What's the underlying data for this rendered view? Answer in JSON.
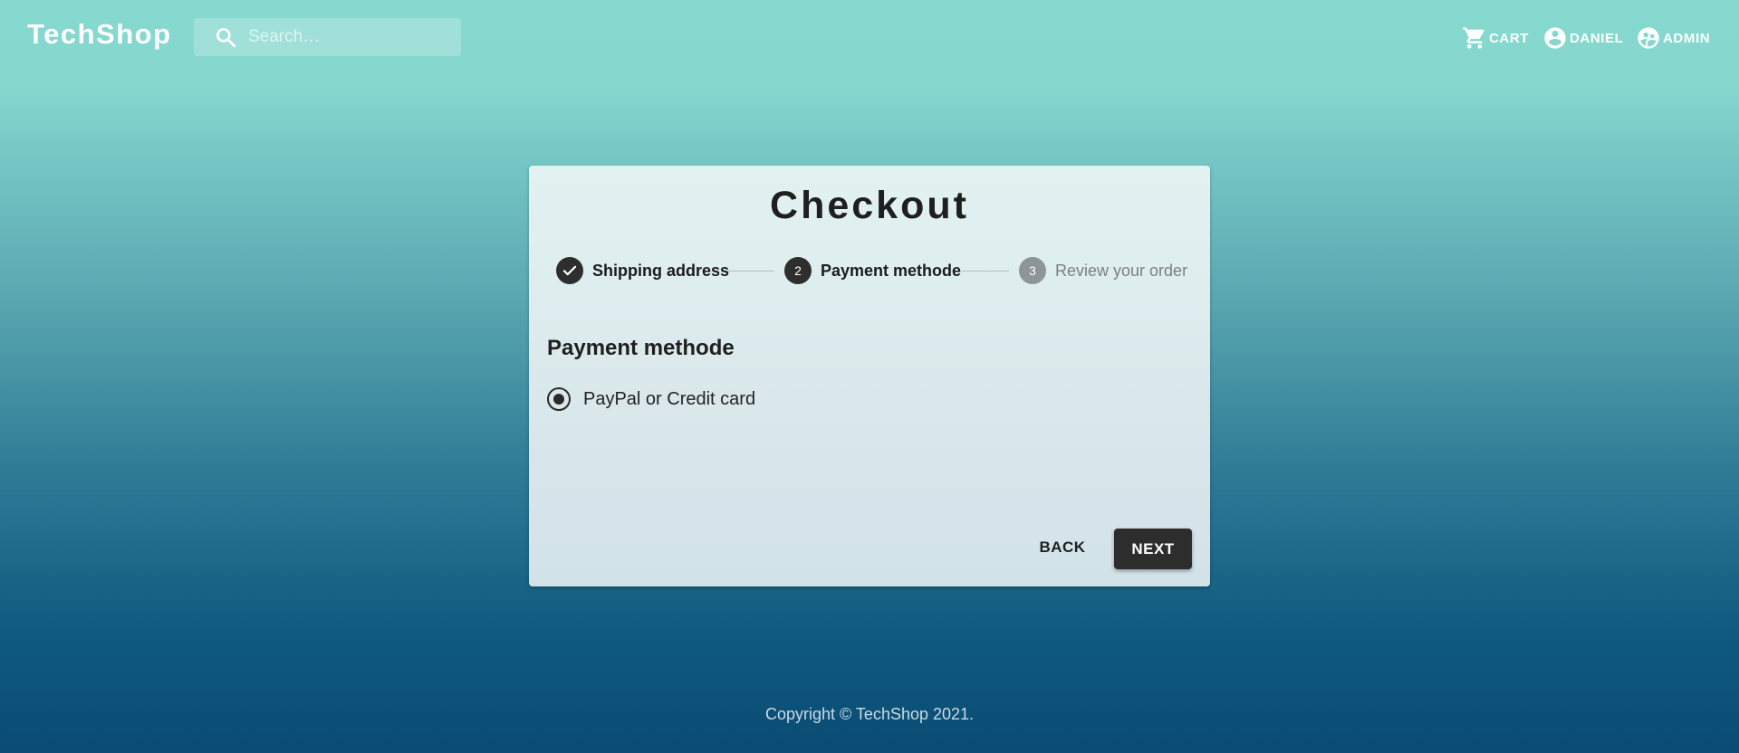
{
  "header": {
    "brand": "TechShop",
    "search": {
      "placeholder": "Search…",
      "icon": "search-icon"
    },
    "nav": [
      {
        "label": "CART",
        "icon": "cart-icon"
      },
      {
        "label": "DANIEL",
        "icon": "account-circle-icon"
      },
      {
        "label": "ADMIN",
        "icon": "supervisor-account-icon"
      }
    ]
  },
  "checkout": {
    "title": "Checkout",
    "steps": [
      {
        "label": "Shipping address",
        "state": "completed",
        "marker": "check-icon"
      },
      {
        "label": "Payment methode",
        "state": "active",
        "number": "2"
      },
      {
        "label": "Review your order",
        "state": "pending",
        "number": "3"
      }
    ],
    "section_title": "Payment methode",
    "payment_option": {
      "label": "PayPal or Credit card",
      "selected": true
    },
    "buttons": {
      "back": "BACK",
      "next": "NEXT"
    }
  },
  "footer": {
    "copyright": "Copyright © TechShop 2021."
  },
  "colors": {
    "primary_dark": "#2e2e2e",
    "step_pending": "#8e9598",
    "gradient_top": "#85d9cf",
    "gradient_bottom": "#0a4b74"
  }
}
